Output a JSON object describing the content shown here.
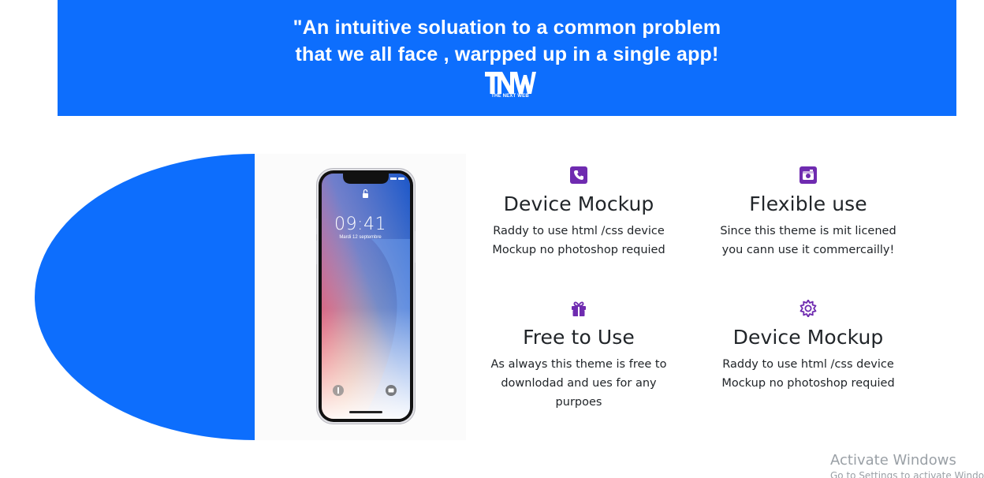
{
  "banner": {
    "quote_line1": "\"An intuitive soluation to a common problem",
    "quote_line2": "that we all face , warpped up in a single app!",
    "logo_name": "TNW",
    "logo_caption": "THE NEXT WEB",
    "background_color": "#0d6efd"
  },
  "phone": {
    "time": "09:41",
    "date": "Mardi 12 septembre"
  },
  "features": [
    {
      "icon": "phone-icon",
      "title": "Device Mockup",
      "line1": "Raddy to use html /css device",
      "line2": "Mockup no photoshop requied",
      "line3": ""
    },
    {
      "icon": "camera-icon",
      "title": "Flexible use",
      "line1": "Since this theme is mit licened",
      "line2": "you cann use it commercailly!",
      "line3": ""
    },
    {
      "icon": "gift-icon",
      "title": "Free to Use",
      "line1": "As always this theme is free to",
      "line2": "downlodad and ues for any",
      "line3": "purpoes"
    },
    {
      "icon": "gear-icon",
      "title": "Device Mockup",
      "line1": "Raddy to use html /css device",
      "line2": "Mockup no photoshop requied",
      "line3": ""
    }
  ],
  "watermark": {
    "title": "Activate Windows",
    "subtitle": "Go to Settings to activate Windows."
  },
  "colors": {
    "accent_blue": "#0d6efd",
    "icon_purple": "#6f2bb0",
    "text_dark": "#212529"
  }
}
